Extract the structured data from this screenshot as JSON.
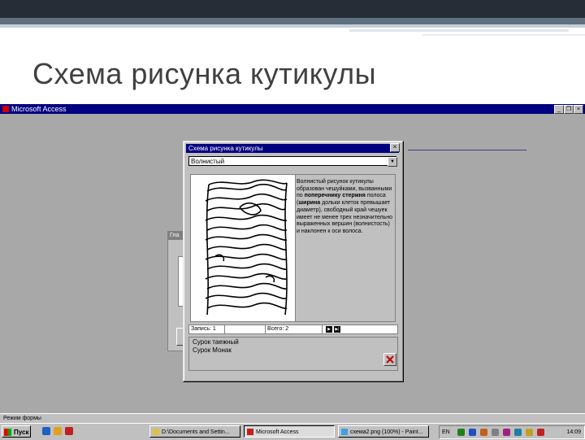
{
  "slide": {
    "title": "Схема рисунка кутикулы"
  },
  "app": {
    "title": "Microsoft Access",
    "controls": {
      "minimize": "_",
      "restore": "❐",
      "close": "×"
    },
    "statusbar": "Режим формы"
  },
  "background_form": {
    "title": "Гла"
  },
  "dialog": {
    "title": "Схема рисунка кутикулы",
    "close": "×",
    "combo_value": "Волнистый",
    "combo_arrow": "▼",
    "description_parts": [
      "Волнистый рисунок кутикулы образован чешуйками, вызванными по ",
      "поперечнику стержня",
      " полоса (",
      "ширина",
      " дольки клеток превышает диаметр), свободный край чешуек имеет не менее трех незначительно выраженных вершин (волнистость) и наклонен к оси волоса."
    ],
    "nav": {
      "record_label": "Запись: 1",
      "count_label": "Всего: 2",
      "first": "|◀",
      "prev": "◀",
      "next": "▶",
      "last": "▶|"
    },
    "info_lines": [
      "Сурок таежный",
      "Сурок Монак"
    ]
  },
  "taskbar": {
    "start_label": "Пуск",
    "tasks": [
      {
        "label": "D:\\Documents and Settin..."
      },
      {
        "label": "Microsoft Access"
      },
      {
        "label": "схема2.png (100%) - Paint..."
      }
    ],
    "lang": "EN",
    "clock": "14:09"
  },
  "colors": {
    "titlebar": "#000080",
    "face": "#c0c0c0",
    "desktop": "#a8a8a8",
    "slide_top": "#262d36"
  }
}
